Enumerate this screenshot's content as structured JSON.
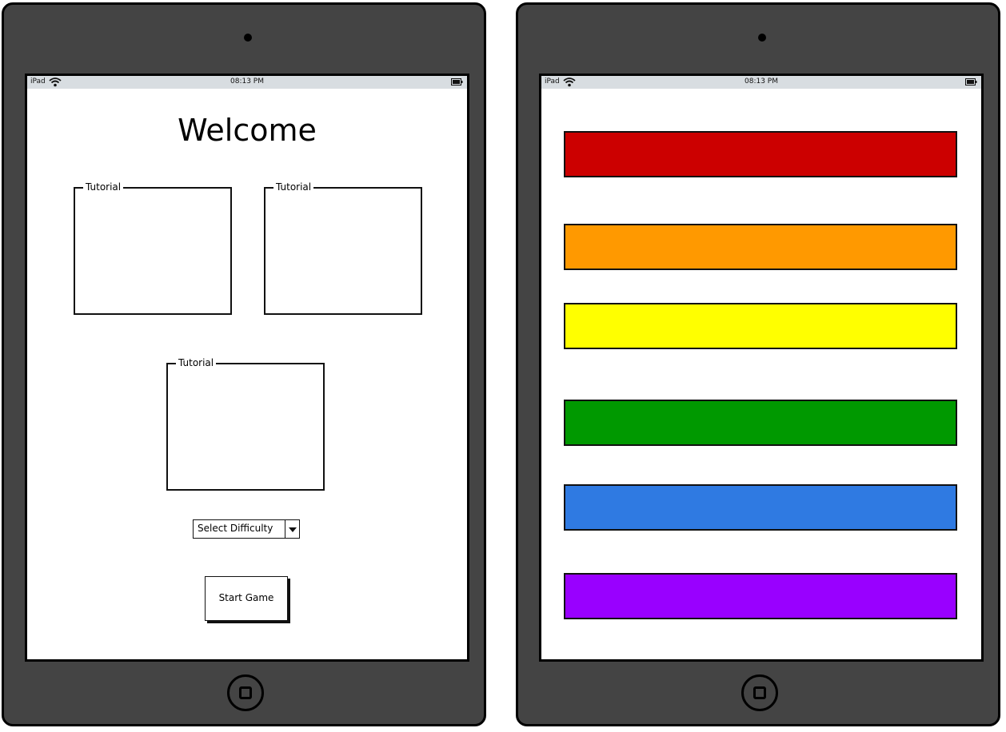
{
  "left_ipad": {
    "status_bar": {
      "model": "iPad",
      "time": "08:13 PM"
    },
    "title": "Welcome",
    "tutorials": [
      {
        "label": "Tutorial"
      },
      {
        "label": "Tutorial"
      },
      {
        "label": "Tutorial"
      }
    ],
    "difficulty_select": {
      "value": "Select Difficulty"
    },
    "start_button": {
      "label": "Start Game"
    }
  },
  "right_ipad": {
    "status_bar": {
      "model": "iPad",
      "time": "08:13 PM"
    },
    "color_bars": [
      {
        "name": "red",
        "color": "#cc0000"
      },
      {
        "name": "orange",
        "color": "#ff9900"
      },
      {
        "name": "yellow",
        "color": "#ffff00"
      },
      {
        "name": "green",
        "color": "#009900"
      },
      {
        "name": "blue",
        "color": "#2f7ae2"
      },
      {
        "name": "purple",
        "color": "#9900ff"
      }
    ]
  },
  "colors": {
    "device_body": "#444444",
    "status_bar_bg": "#d8dde1",
    "screen_bg": "#ffffff"
  }
}
